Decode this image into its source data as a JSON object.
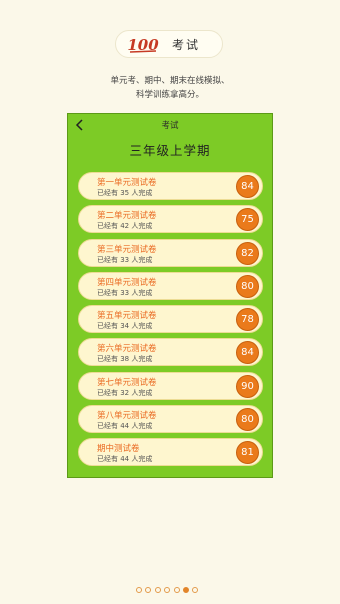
{
  "header": {
    "logo_text": "100",
    "title": "考试"
  },
  "description": {
    "line1": "单元考、期中、期末在线模拟、",
    "line2": "科学训练拿高分。"
  },
  "phone": {
    "topbar_title": "考试",
    "page_title": "三年级上学期",
    "exams": [
      {
        "name": "第一单元测试卷",
        "done": "已经有 35 人完成",
        "score": "84"
      },
      {
        "name": "第二单元测试卷",
        "done": "已经有 42 人完成",
        "score": "75"
      },
      {
        "name": "第三单元测试卷",
        "done": "已经有 33 人完成",
        "score": "82"
      },
      {
        "name": "第四单元测试卷",
        "done": "已经有 33 人完成",
        "score": "80"
      },
      {
        "name": "第五单元测试卷",
        "done": "已经有 34 人完成",
        "score": "78"
      },
      {
        "name": "第六单元测试卷",
        "done": "已经有 38 人完成",
        "score": "84"
      },
      {
        "name": "第七单元测试卷",
        "done": "已经有 32 人完成",
        "score": "90"
      },
      {
        "name": "第八单元测试卷",
        "done": "已经有 44 人完成",
        "score": "80"
      },
      {
        "name": "期中测试卷",
        "done": "已经有 44 人完成",
        "score": "81"
      }
    ]
  },
  "pagination": {
    "count": 7,
    "active_index": 5
  },
  "colors": {
    "accent": "#ea7a1b",
    "panel_green": "#7dcb26",
    "background": "#fbf8e9"
  }
}
